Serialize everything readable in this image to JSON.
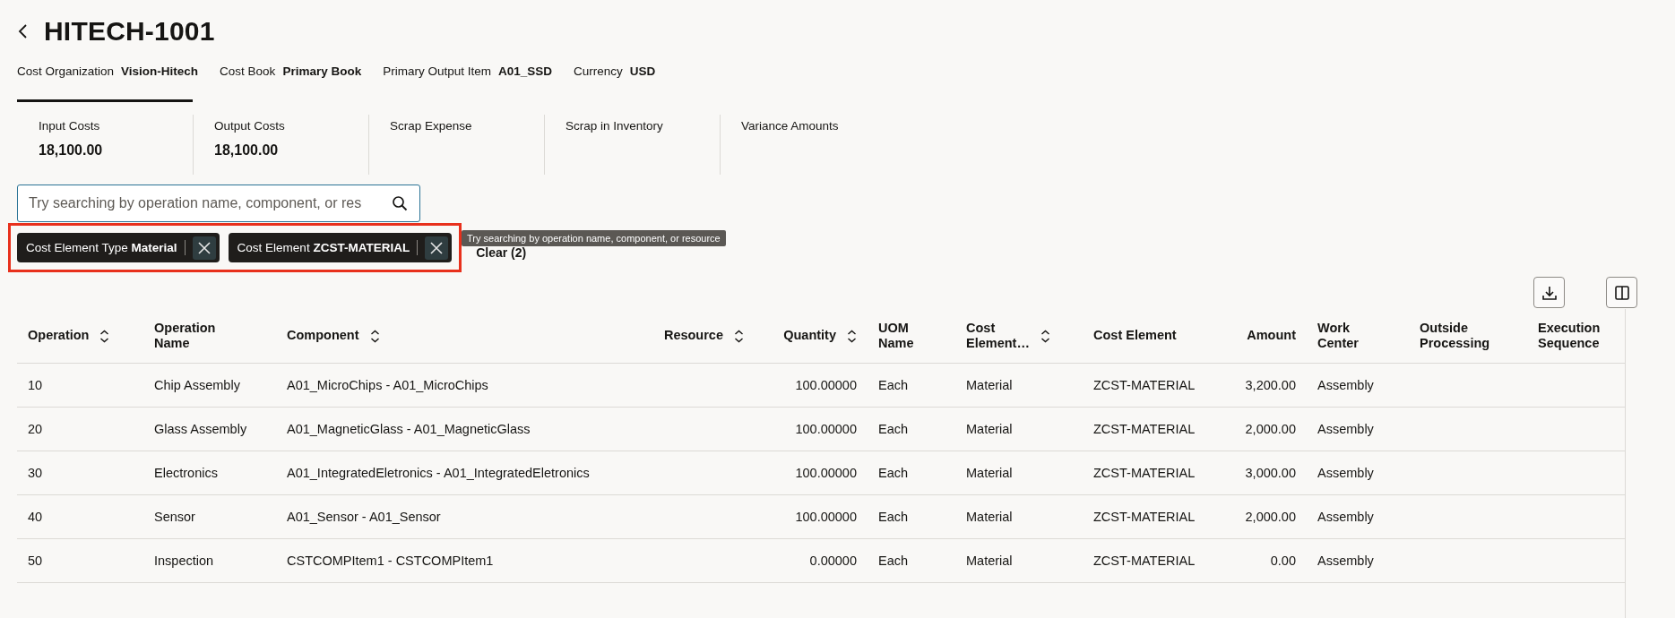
{
  "page": {
    "title": "HITECH-1001"
  },
  "meta": [
    {
      "label": "Cost Organization",
      "value": "Vision-Hitech"
    },
    {
      "label": "Cost Book",
      "value": "Primary Book"
    },
    {
      "label": "Primary Output Item",
      "value": "A01_SSD"
    },
    {
      "label": "Currency",
      "value": "USD"
    }
  ],
  "tabs": [
    {
      "label": "Input Costs",
      "value": "18,100.00",
      "selected": true
    },
    {
      "label": "Output Costs",
      "value": "18,100.00",
      "selected": false
    },
    {
      "label": "Scrap Expense",
      "selected": false
    },
    {
      "label": "Scrap in Inventory",
      "selected": false
    },
    {
      "label": "Variance Amounts",
      "selected": false
    }
  ],
  "search": {
    "placeholder": "Try searching by operation name, component, or res"
  },
  "filters": [
    {
      "text": "Cost Element Type **Material**"
    },
    {
      "text": "Cost Element **ZCST-MATERIAL**"
    }
  ],
  "clear_link": "Clear (2)",
  "tooltip": "Try searching by operation name, component, or resource",
  "table": {
    "columns": [
      {
        "label": "Operation",
        "sortable": true,
        "kind": "text"
      },
      {
        "label": "Operation\nName",
        "sortable": false,
        "kind": "text"
      },
      {
        "label": "Component",
        "sortable": true,
        "kind": "text"
      },
      {
        "label": "Resource",
        "sortable": true,
        "kind": "number"
      },
      {
        "label": "Quantity",
        "sortable": true,
        "kind": "number"
      },
      {
        "label": "UOM\nName",
        "sortable": false,
        "kind": "text"
      },
      {
        "label": "Cost\nElement…",
        "sortable": true,
        "kind": "text"
      },
      {
        "label": "Cost Element",
        "sortable": false,
        "kind": "text"
      },
      {
        "label": "Amount",
        "sortable": false,
        "kind": "number"
      },
      {
        "label": "Work\nCenter",
        "sortable": false,
        "kind": "text"
      },
      {
        "label": "Outside\nProcessing",
        "sortable": false,
        "kind": "text"
      },
      {
        "label": "Execution\nSequence",
        "sortable": false,
        "kind": "text"
      }
    ],
    "rows": [
      {
        "operation": "10",
        "operation_name": "Chip Assembly",
        "component": "A01_MicroChips - A01_MicroChips",
        "quantity": "100.00000",
        "uom_name": "Each",
        "cost_element_type": "Material",
        "cost_element": "ZCST-MATERIAL",
        "amount": "3,200.00",
        "work_center": "Assembly"
      },
      {
        "operation": "20",
        "operation_name": "Glass Assembly",
        "component": "A01_MagneticGlass - A01_MagneticGlass",
        "quantity": "100.00000",
        "uom_name": "Each",
        "cost_element_type": "Material",
        "cost_element": "ZCST-MATERIAL",
        "amount": "2,000.00",
        "work_center": "Assembly"
      },
      {
        "operation": "30",
        "operation_name": "Electronics",
        "component": "A01_IntegratedEletronics - A01_IntegratedEletronics",
        "quantity": "100.00000",
        "uom_name": "Each",
        "cost_element_type": "Material",
        "cost_element": "ZCST-MATERIAL",
        "amount": "3,000.00",
        "work_center": "Assembly"
      },
      {
        "operation": "40",
        "operation_name": "Sensor",
        "component": "A01_Sensor - A01_Sensor",
        "quantity": "100.00000",
        "uom_name": "Each",
        "cost_element_type": "Material",
        "cost_element": "ZCST-MATERIAL",
        "amount": "2,000.00",
        "work_center": "Assembly"
      },
      {
        "operation": "50",
        "operation_name": "Inspection",
        "component": "CSTCOMPItem1 - CSTCOMPItem1",
        "quantity": "0.00000",
        "uom_name": "Each",
        "cost_element_type": "Material",
        "cost_element": "ZCST-MATERIAL",
        "amount": "0.00",
        "work_center": "Assembly"
      }
    ]
  }
}
